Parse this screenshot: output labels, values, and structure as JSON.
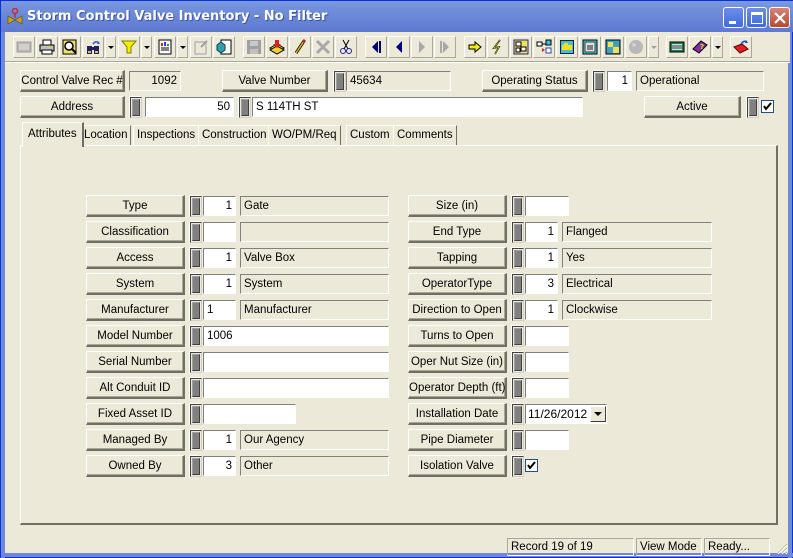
{
  "window": {
    "title": "Storm Control Valve Inventory - No Filter",
    "controls": [
      "minimize",
      "maximize",
      "close"
    ]
  },
  "toolbar": {
    "buttons": [
      {
        "name": "view-grid-icon",
        "enabled": false
      },
      {
        "name": "print-icon",
        "enabled": true
      },
      {
        "name": "print-preview-icon",
        "enabled": true
      },
      {
        "name": "search-binoculars-icon",
        "enabled": true,
        "dropdown": true
      },
      {
        "name": "filter-icon",
        "enabled": true,
        "dropdown": true
      },
      {
        "name": "report-icon",
        "enabled": true,
        "dropdown": true
      },
      {
        "name": "edit-document-icon",
        "enabled": false
      },
      {
        "name": "export-document-icon",
        "enabled": true
      },
      {
        "name": "save-icon",
        "enabled": false
      },
      {
        "name": "add-record-icon",
        "enabled": true
      },
      {
        "name": "edit-pencil-icon",
        "enabled": true
      },
      {
        "name": "delete-icon",
        "enabled": false
      },
      {
        "name": "cut-icon",
        "enabled": true
      },
      {
        "name": "first-record-icon",
        "enabled": true
      },
      {
        "name": "previous-record-icon",
        "enabled": true
      },
      {
        "name": "next-record-icon",
        "enabled": false
      },
      {
        "name": "last-record-icon",
        "enabled": false
      },
      {
        "name": "go-to-icon",
        "enabled": true
      },
      {
        "name": "lightning-icon",
        "enabled": true
      },
      {
        "name": "map-link-icon",
        "enabled": true
      },
      {
        "name": "hierarchy-icon",
        "enabled": true
      },
      {
        "name": "equipment-icon",
        "enabled": true
      },
      {
        "name": "calculator-icon",
        "enabled": true
      },
      {
        "name": "map-tools-icon",
        "enabled": true
      },
      {
        "name": "globe-icon",
        "enabled": false,
        "dropdown": true
      },
      {
        "name": "calendar-grid-icon",
        "enabled": true
      },
      {
        "name": "help-book-icon",
        "enabled": true,
        "dropdown": true
      },
      {
        "name": "exit-icon",
        "enabled": true
      }
    ]
  },
  "header": {
    "rec_label": "Control Valve Rec #",
    "rec_value": "1092",
    "valve_number_label": "Valve Number",
    "valve_number_value": "45634",
    "operating_status_label": "Operating Status",
    "operating_status_code": "1",
    "operating_status_value": "Operational",
    "address_label": "Address",
    "address_number": "50",
    "address_street": "S 114TH ST",
    "active_label": "Active",
    "active_checked": true
  },
  "tabs": [
    {
      "label": "Attributes",
      "active": true
    },
    {
      "label": "Location",
      "active": false
    },
    {
      "label": "Inspections",
      "active": false
    },
    {
      "label": "Construction",
      "active": false
    },
    {
      "label": "WO/PM/Req",
      "active": false
    },
    {
      "label": "Custom",
      "active": false
    },
    {
      "label": "Comments",
      "active": false
    }
  ],
  "attributes": {
    "left": [
      {
        "label": "Type",
        "code": "1",
        "value": "Gate"
      },
      {
        "label": "Classification",
        "code": "",
        "value": ""
      },
      {
        "label": "Access",
        "code": "1",
        "value": "Valve Box"
      },
      {
        "label": "System",
        "code": "1",
        "value": "System"
      },
      {
        "label": "Manufacturer",
        "code": "1",
        "value": "Manufacturer"
      },
      {
        "label": "Model Number",
        "value": "1006"
      },
      {
        "label": "Serial Number",
        "value": ""
      },
      {
        "label": "Alt Conduit ID",
        "value": ""
      },
      {
        "label": "Fixed Asset ID",
        "value": ""
      },
      {
        "label": "Managed By",
        "code": "1",
        "value": "Our Agency"
      },
      {
        "label": "Owned By",
        "code": "3",
        "value": "Other"
      }
    ],
    "right": [
      {
        "label": "Size (in)",
        "value": ""
      },
      {
        "label": "End Type",
        "code": "1",
        "value": "Flanged"
      },
      {
        "label": "Tapping",
        "code": "1",
        "value": "Yes"
      },
      {
        "label": "OperatorType",
        "code": "3",
        "value": "Electrical"
      },
      {
        "label": "Direction to Open",
        "code": "1",
        "value": "Clockwise"
      },
      {
        "label": "Turns to Open",
        "value": ""
      },
      {
        "label": "Oper Nut Size (in)",
        "value": ""
      },
      {
        "label": "Operator Depth (ft)",
        "value": ""
      },
      {
        "label": "Installation Date",
        "value": "11/26/2012"
      },
      {
        "label": "Pipe Diameter",
        "value": ""
      },
      {
        "label": "Isolation Valve",
        "checked": true
      }
    ]
  },
  "status_bar": {
    "record": "Record 19 of 19",
    "mode": "View Mode",
    "state": "Ready..."
  }
}
